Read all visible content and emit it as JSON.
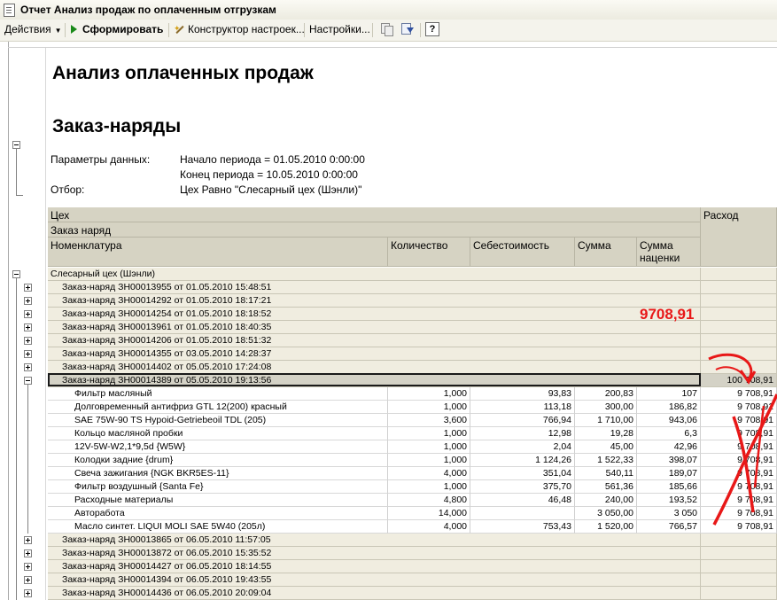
{
  "window": {
    "title": "Отчет  Анализ продаж по оплаченным отгрузкам"
  },
  "toolbar": {
    "actions": "Действия",
    "generate": "Сформировать",
    "constructor": "Конструктор настроек...",
    "settings": "Настройки...",
    "help": "?"
  },
  "report": {
    "title": "Анализ оплаченных продаж",
    "subtitle": "Заказ-наряды",
    "params_label": "Параметры данных:",
    "period_start": "Начало периода = 01.05.2010 0:00:00",
    "period_end": "Конец периода = 10.05.2010 0:00:00",
    "filter_label": "Отбор:",
    "filter_value": "Цех Равно \"Слесарный цех (Шэнли)\""
  },
  "table": {
    "headers": {
      "workshop": "Цех",
      "order": "Заказ наряд",
      "nomenclature": "Номенклатура",
      "quantity": "Количество",
      "cost": "Себестоимость",
      "sum": "Сумма",
      "markup_line1": "Сумма",
      "markup_line2": "наценки",
      "expense": "Расход"
    },
    "group": "Слесарный цех (Шэнли)",
    "orders_before": [
      "Заказ-наряд ЗН00013955 от 01.05.2010 15:48:51",
      "Заказ-наряд ЗН00014292 от 01.05.2010 18:17:21",
      "Заказ-наряд ЗН00014254 от 01.05.2010 18:18:52",
      "Заказ-наряд ЗН00013961 от 01.05.2010 18:40:35",
      "Заказ-наряд ЗН00014206 от 01.05.2010 18:51:32",
      "Заказ-наряд ЗН00014355 от 03.05.2010 14:28:37",
      "Заказ-наряд ЗН00014402 от 05.05.2010 17:24:08"
    ],
    "expanded_order": {
      "label": "Заказ-наряд ЗН00014389 от 05.05.2010 19:13:56",
      "expense": "100 708,91"
    },
    "items": [
      {
        "name": "Фильтр масляный",
        "qty": "1,000",
        "cost": "93,83",
        "sum": "200,83",
        "markup": "107",
        "expense": "9 708,91"
      },
      {
        "name": "Долговременный антифриз GTL 12(200) красный",
        "qty": "1,000",
        "cost": "113,18",
        "sum": "300,00",
        "markup": "186,82",
        "expense": "9 708,91"
      },
      {
        "name": "SAE 75W-90 TS Hypoid-Getriebeoil TDL (205)",
        "qty": "3,600",
        "cost": "766,94",
        "sum": "1 710,00",
        "markup": "943,06",
        "expense": "9 708,91"
      },
      {
        "name": "Кольцо масляной пробки",
        "qty": "1,000",
        "cost": "12,98",
        "sum": "19,28",
        "markup": "6,3",
        "expense": "9 708,91"
      },
      {
        "name": "12V-5W-W2,1*9,5d {W5W}",
        "qty": "1,000",
        "cost": "2,04",
        "sum": "45,00",
        "markup": "42,96",
        "expense": "9 708,91"
      },
      {
        "name": "Колодки задние {drum}",
        "qty": "1,000",
        "cost": "1 124,26",
        "sum": "1 522,33",
        "markup": "398,07",
        "expense": "9 708,91"
      },
      {
        "name": "Свеча зажигания {NGK BKR5ES-11}",
        "qty": "4,000",
        "cost": "351,04",
        "sum": "540,11",
        "markup": "189,07",
        "expense": "9 708,91"
      },
      {
        "name": "Фильтр воздушный {Santa Fe}",
        "qty": "1,000",
        "cost": "375,70",
        "sum": "561,36",
        "markup": "185,66",
        "expense": "9 708,91"
      },
      {
        "name": "Расходные материалы",
        "qty": "4,800",
        "cost": "46,48",
        "sum": "240,00",
        "markup": "193,52",
        "expense": "9 708,91"
      },
      {
        "name": "Авторабота",
        "qty": "14,000",
        "cost": "",
        "sum": "3 050,00",
        "markup": "3 050",
        "expense": "9 708,91"
      },
      {
        "name": "Масло синтет. LIQUI MOLI SAE 5W40 (205л)",
        "qty": "4,000",
        "cost": "753,43",
        "sum": "1 520,00",
        "markup": "766,57",
        "expense": "9 708,91"
      }
    ],
    "orders_after": [
      "Заказ-наряд ЗН00013865 от 06.05.2010 11:57:05",
      "Заказ-наряд ЗН00013872 от 06.05.2010 15:35:52",
      "Заказ-наряд ЗН00014427 от 06.05.2010 18:14:55",
      "Заказ-наряд ЗН00014394 от 06.05.2010 19:43:55",
      "Заказ-наряд ЗН00014436 от 06.05.2010 20:09:04"
    ]
  },
  "annotation": {
    "text": "9708,91",
    "color": "#e81818"
  }
}
